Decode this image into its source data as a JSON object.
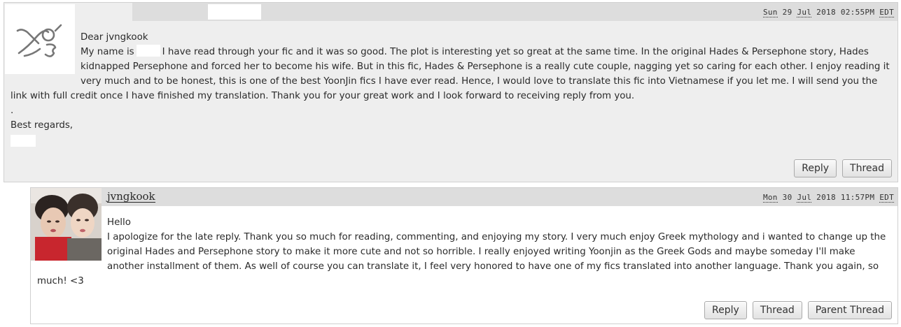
{
  "comment1": {
    "datetime": {
      "dow": "Sun",
      "day": "29",
      "month": "Jul",
      "year": "2018",
      "time": "02:55PM",
      "tz": "EDT"
    },
    "icon": "default-userpic-icon",
    "greeting": "Dear jvngkook",
    "line_start": "My name is",
    "text": "I have read through your fic and it was so good. The plot is interesting yet so great at the same time. In the original Hades & Persephone story, Hades kidnapped Persephone and forced her to become his wife. But in this fic, Hades & Persephone is a really cute couple, nagging yet so caring for each other. I enjoy reading it very much and to be honest, this is one of the best YoonJin fics I have ever read. Hence, I would love to translate this fic into Vietnamese if you let me. I will send you the link with full credit once I have finished my translation. Thank you for your great work and I look forward to receiving reply from you.",
    "dot": ".",
    "closing": "Best regards,",
    "buttons": {
      "reply": "Reply",
      "thread": "Thread"
    }
  },
  "comment2": {
    "username": "jvngkook",
    "datetime": {
      "dow": "Mon",
      "day": "30",
      "month": "Jul",
      "year": "2018",
      "time": "11:57PM",
      "tz": "EDT"
    },
    "icon": "user-avatar-photo",
    "greeting": "Hello",
    "text": "I apologize for the late reply. Thank you so much for reading, commenting, and enjoying my story. I very much enjoy Greek mythology and i wanted to change up the original Hades and Persephone story to make it more cute and not so horrible. I really enjoyed writing Yoonjin as the Greek Gods and maybe someday I'll make another installment of them. As well of course you can translate it, I feel very honored to have one of my fics translated into another language. Thank you again, so much! <3",
    "buttons": {
      "reply": "Reply",
      "thread": "Thread",
      "parent_thread": "Parent Thread"
    }
  }
}
